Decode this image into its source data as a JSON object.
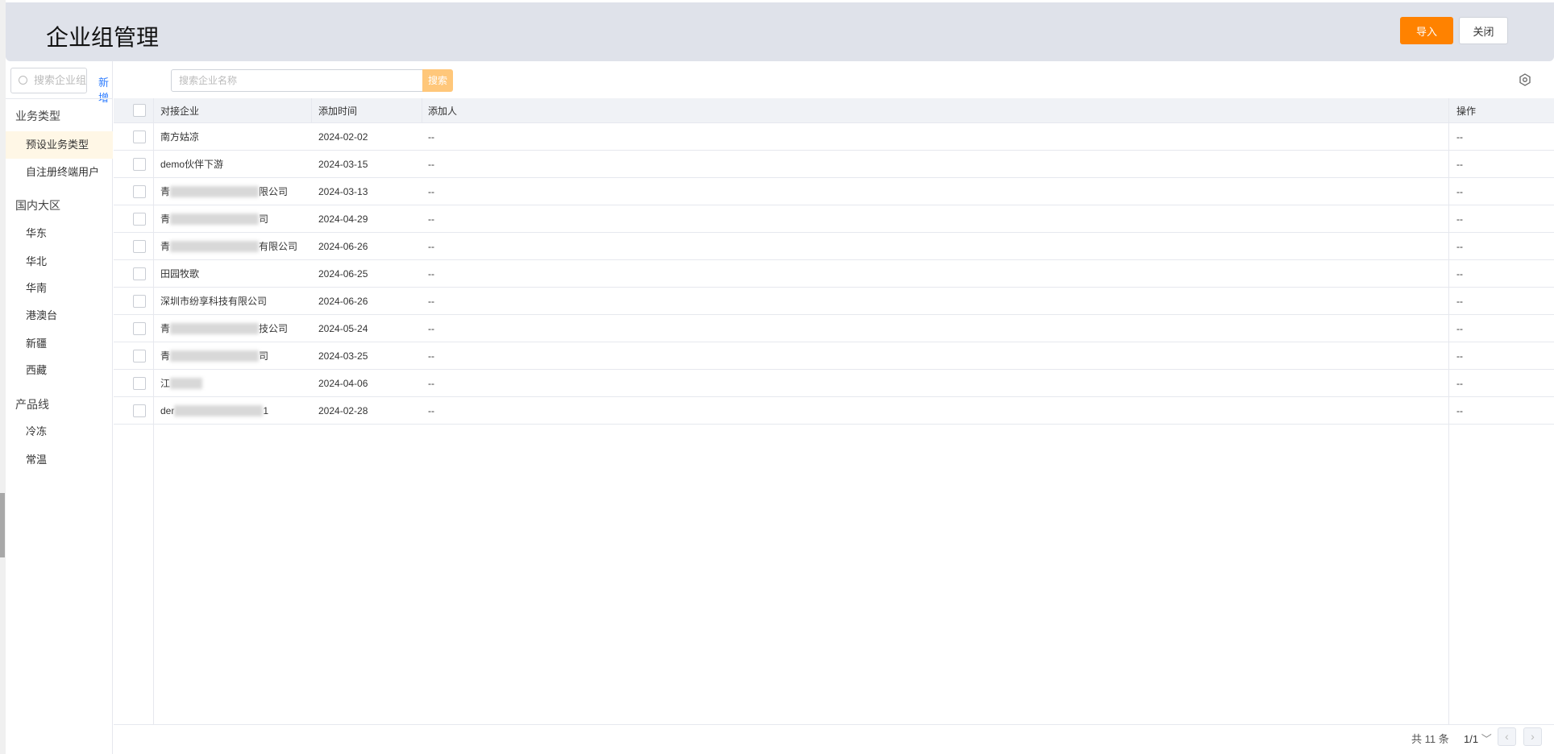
{
  "header": {
    "title": "企业组管理",
    "import_label": "导入",
    "close_label": "关闭"
  },
  "sidebar": {
    "search_placeholder": "搜索企业组",
    "add_label": "新增",
    "groups": [
      {
        "label": "业务类型",
        "items": [
          "预设业务类型",
          "自注册终端用户"
        ]
      },
      {
        "label": "国内大区",
        "items": [
          "华东",
          "华北",
          "华南",
          "港澳台",
          "新疆",
          "西藏"
        ]
      },
      {
        "label": "产品线",
        "items": [
          "冷冻",
          "常温"
        ]
      }
    ],
    "active_item": "预设业务类型"
  },
  "toolbar": {
    "search_placeholder": "搜索企业名称",
    "search_label": "搜索"
  },
  "table": {
    "columns": [
      "对接企业",
      "添加时间",
      "添加人",
      "操作"
    ],
    "rows": [
      {
        "company": "南方姑凉",
        "time": "2024-02-02",
        "adder": "--",
        "op": "--"
      },
      {
        "company": "demo伙伴下游",
        "time": "2024-03-15",
        "adder": "--",
        "op": "--"
      },
      {
        "company": "青",
        "suffix": "限公司",
        "redacted": true,
        "time": "2024-03-13",
        "adder": "--",
        "op": "--"
      },
      {
        "company": "青",
        "suffix": "司",
        "redacted": true,
        "time": "2024-04-29",
        "adder": "--",
        "op": "--"
      },
      {
        "company": "青",
        "suffix": "有限公司",
        "redacted": true,
        "time": "2024-06-26",
        "adder": "--",
        "op": "--"
      },
      {
        "company": "田园牧歌",
        "time": "2024-06-25",
        "adder": "--",
        "op": "--"
      },
      {
        "company": "深圳市纷享科技有限公司",
        "time": "2024-06-26",
        "adder": "--",
        "op": "--"
      },
      {
        "company": "青",
        "suffix": "技公司",
        "redacted": true,
        "time": "2024-05-24",
        "adder": "--",
        "op": "--"
      },
      {
        "company": "青",
        "suffix": "司",
        "redacted": true,
        "time": "2024-03-25",
        "adder": "--",
        "op": "--"
      },
      {
        "company": "江",
        "suffix": "",
        "redacted": true,
        "time": "2024-04-06",
        "adder": "--",
        "op": "--"
      },
      {
        "company": "der",
        "suffix": "1",
        "redacted": true,
        "time": "2024-02-28",
        "adder": "--",
        "op": "--"
      }
    ]
  },
  "pagination": {
    "total": "共 11 条",
    "page": "1/1"
  },
  "colors": {
    "accent": "#ff8200",
    "link": "#2f7dff",
    "header_bg": "#dfe2ea"
  }
}
